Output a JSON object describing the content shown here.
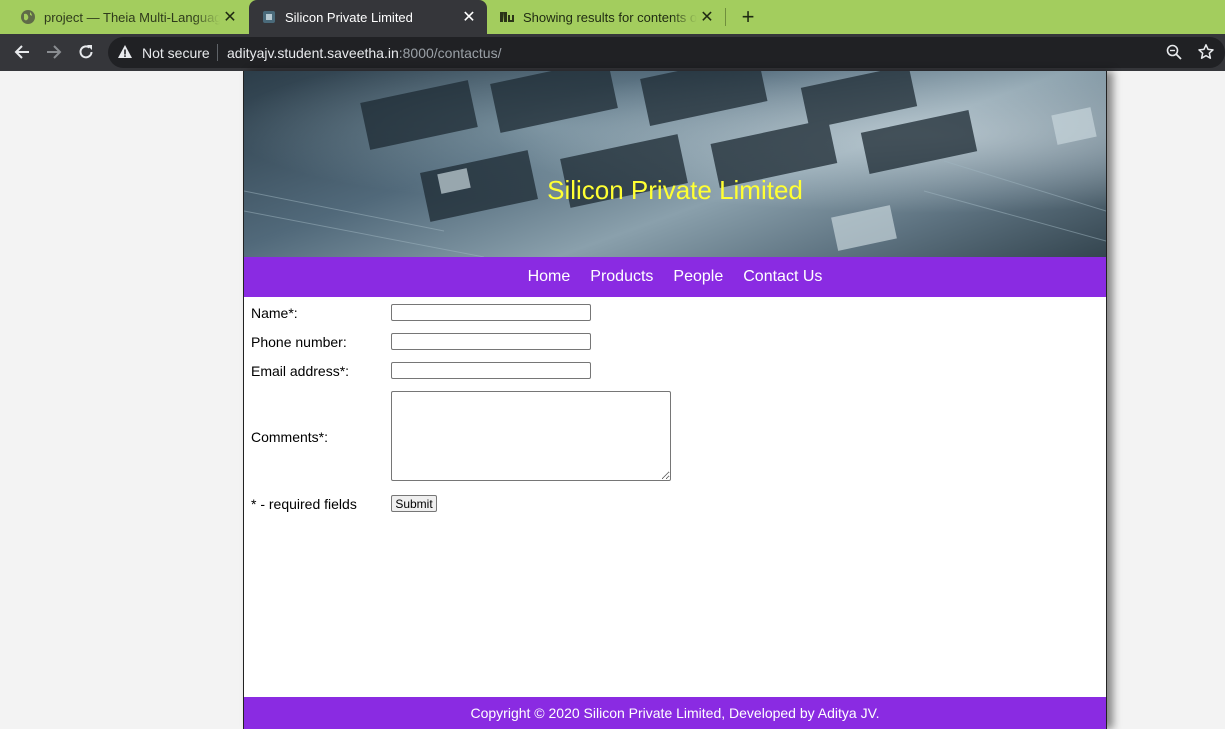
{
  "browser": {
    "tabs": [
      {
        "title": "project — Theia Multi-Language",
        "favicon": "globe-icon",
        "active": false
      },
      {
        "title": "Silicon Private Limited",
        "favicon": "chip-icon",
        "active": true
      },
      {
        "title": "Showing results for contents of t",
        "favicon": "nu-icon",
        "active": false
      }
    ],
    "close_glyph": "✕",
    "new_tab_glyph": "+",
    "security_label": "Not secure",
    "url_host": "adityajv.student.saveetha.in",
    "url_path": ":8000/contactus/",
    "accent_color": "#a3cd5e"
  },
  "site": {
    "banner_title": "Silicon Private Limited",
    "banner_title_color": "#ffff33",
    "brand_color": "#8a2be2",
    "nav": [
      "Home",
      "Products",
      "People",
      "Contact Us"
    ]
  },
  "form": {
    "name_label": "Name*:",
    "phone_label": "Phone number:",
    "email_label": "Email address*:",
    "comments_label": "Comments*:",
    "required_note": "* - required fields",
    "submit_label": "Submit",
    "name_value": "",
    "phone_value": "",
    "email_value": "",
    "comments_value": ""
  },
  "footer": {
    "text": "Copyright © 2020 Silicon Private Limited, Developed by Aditya JV."
  }
}
